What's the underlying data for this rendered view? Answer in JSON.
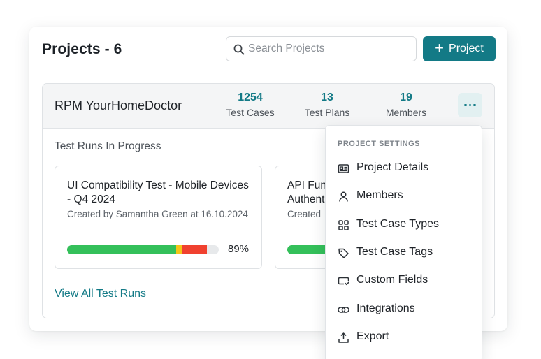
{
  "header": {
    "title": "Projects - 6",
    "search_placeholder": "Search Projects",
    "add_button_label": "Project"
  },
  "project": {
    "name": "RPM YourHomeDoctor",
    "stats": [
      {
        "value": "1254",
        "label": "Test Cases"
      },
      {
        "value": "13",
        "label": "Test Plans"
      },
      {
        "value": "19",
        "label": "Members"
      }
    ],
    "runs_section_title": "Test Runs In Progress",
    "runs": [
      {
        "title": "UI Compatibility Test - Mobile Devices - Q4 2024",
        "meta": "Created by Samantha Green at 16.10.2024",
        "progress_label": "89%",
        "progress": {
          "passed": 0.72,
          "blocked": 0.04,
          "failed": 0.16
        }
      },
      {
        "title": "API Functional Tests - User Authentication",
        "meta": "Created",
        "progress_label": "",
        "progress": {
          "passed": 0.3,
          "blocked": 0.0,
          "failed": 0.0
        }
      }
    ],
    "view_all_label": "View All Test Runs"
  },
  "menu": {
    "heading": "PROJECT SETTINGS",
    "items": [
      {
        "label": "Project Details",
        "icon": "id-card-icon"
      },
      {
        "label": "Members",
        "icon": "user-icon"
      },
      {
        "label": "Test Case Types",
        "icon": "grid-icon"
      },
      {
        "label": "Test Case Tags",
        "icon": "tag-icon"
      },
      {
        "label": "Custom Fields",
        "icon": "input-field-icon"
      },
      {
        "label": "Integrations",
        "icon": "link-icon"
      },
      {
        "label": "Export",
        "icon": "upload-icon"
      }
    ]
  },
  "colors": {
    "accent": "#137a86",
    "progress_passed": "#34c05a",
    "progress_blocked": "#f5c518",
    "progress_failed": "#f0412f",
    "progress_track": "#e7e9eb"
  }
}
